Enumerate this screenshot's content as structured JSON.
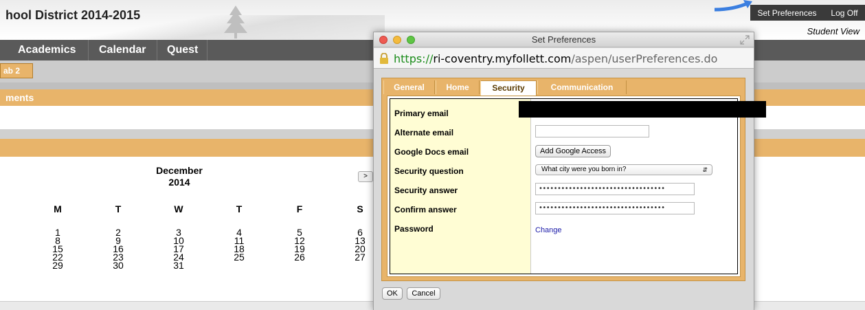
{
  "banner": {
    "school_title": "hool District 2014-2015",
    "links": [
      "Set Preferences",
      "Log Off"
    ],
    "student_view": "Student View"
  },
  "nav": {
    "tabs": [
      "Academics",
      "Calendar",
      "Quest"
    ]
  },
  "subtab": "ab 2",
  "section_label": "ments",
  "calendar": {
    "month": "December",
    "year": "2014",
    "next_button": ">",
    "weekdays": [
      "M",
      "T",
      "W",
      "T",
      "F",
      "S"
    ],
    "weeks": [
      [
        "1",
        "2",
        "3",
        "4",
        "5",
        "6"
      ],
      [
        "8",
        "9",
        "10",
        "11",
        "12",
        "13"
      ],
      [
        "15",
        "16",
        "17",
        "18",
        "19",
        "20"
      ],
      [
        "22",
        "23",
        "24",
        "25",
        "26",
        "27"
      ],
      [
        "29",
        "30",
        "31",
        "",
        "",
        ""
      ]
    ]
  },
  "dialog": {
    "title": "Set Preferences",
    "url": {
      "proto": "https://",
      "host": "ri-coventry.myfollett.com",
      "path": "/aspen/userPreferences.do"
    },
    "tabs": [
      "General",
      "Home",
      "Security",
      "Communication"
    ],
    "active_tab": "Security",
    "fields": {
      "primary_email": {
        "label": "Primary email"
      },
      "alternate_email": {
        "label": "Alternate email",
        "value": ""
      },
      "google_docs": {
        "label": "Google Docs email",
        "button": "Add Google Access"
      },
      "security_question": {
        "label": "Security question",
        "value": "What city were you born in?"
      },
      "security_answer": {
        "label": "Security answer",
        "value": "••••••••••••••••••••••••••••••••••"
      },
      "confirm_answer": {
        "label": "Confirm answer",
        "value": "••••••••••••••••••••••••••••••••••"
      },
      "password": {
        "label": "Password",
        "link": "Change"
      }
    },
    "buttons": {
      "ok": "OK",
      "cancel": "Cancel"
    }
  },
  "colors": {
    "accent_orange": "#e8b46a",
    "nav_gray": "#5a5a5a",
    "label_yellow": "#fffdd4",
    "link_blue": "#1a1aa8"
  }
}
